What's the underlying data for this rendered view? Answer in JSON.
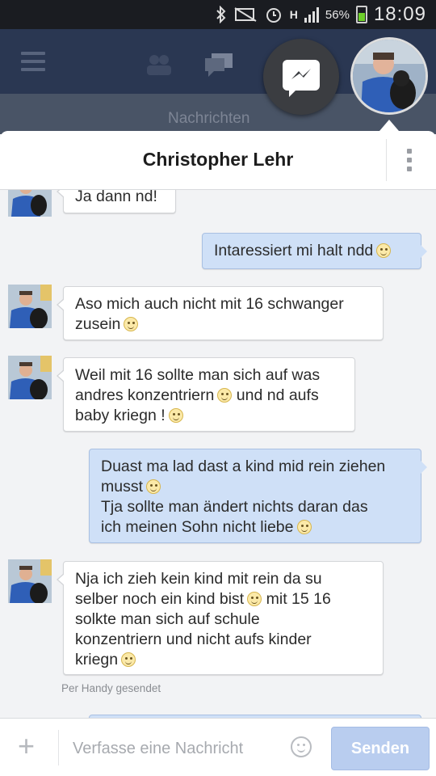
{
  "status_bar": {
    "battery": "56%",
    "time": "18:09",
    "network": "H"
  },
  "app": {
    "tab_label": "Nachrichten"
  },
  "chat": {
    "title": "Christopher Lehr",
    "messages": [
      {
        "from": "them",
        "lines": [
          "Ja dann nd!"
        ]
      },
      {
        "from": "me",
        "lines": [
          "Intaressiert mi halt ndd"
        ]
      },
      {
        "from": "them",
        "lines": [
          "Aso mich auch nicht mit 16 schwanger",
          "zusein"
        ]
      },
      {
        "from": "them",
        "lines": [
          "Weil mit 16 sollte man sich auf was",
          "andres konzentriern",
          "und nd aufs",
          "baby kriegn !"
        ]
      },
      {
        "from": "me",
        "lines": [
          "Duast ma lad dast a kind mid rein ziehen",
          "musst",
          "Tja sollte man ändert nichts daran das",
          "ich meinen Sohn nicht liebe"
        ]
      },
      {
        "from": "them",
        "lines": [
          "Nja ich zieh kein kind mit rein da su",
          "selber noch ein kind bist",
          "mit 15 16",
          "solkte man sich auf schule",
          "konzentriern und nicht aufs kinder",
          "kriegn"
        ]
      }
    ],
    "sent_via": "Per Handy gesendet"
  },
  "composer": {
    "placeholder": "Verfasse eine Nachricht",
    "send_label": "Senden"
  },
  "colors": {
    "header_bg": "#2a3752",
    "outgoing_bubble": "#cfe0f7",
    "send_button": "#b9cdef"
  }
}
